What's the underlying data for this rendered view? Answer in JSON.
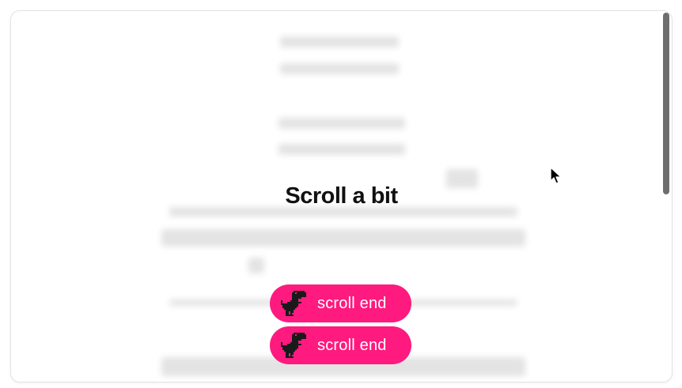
{
  "page": {
    "title": "Scroll a bit"
  },
  "buttons": [
    {
      "label": "scroll end",
      "icon": "dino-icon"
    },
    {
      "label": "scroll end",
      "icon": "dino-icon"
    }
  ],
  "colors": {
    "button_bg": "#ff1a7f",
    "button_text": "#ffffff",
    "title_text": "#111111",
    "scrollbar_thumb": "#6e6e6e"
  }
}
